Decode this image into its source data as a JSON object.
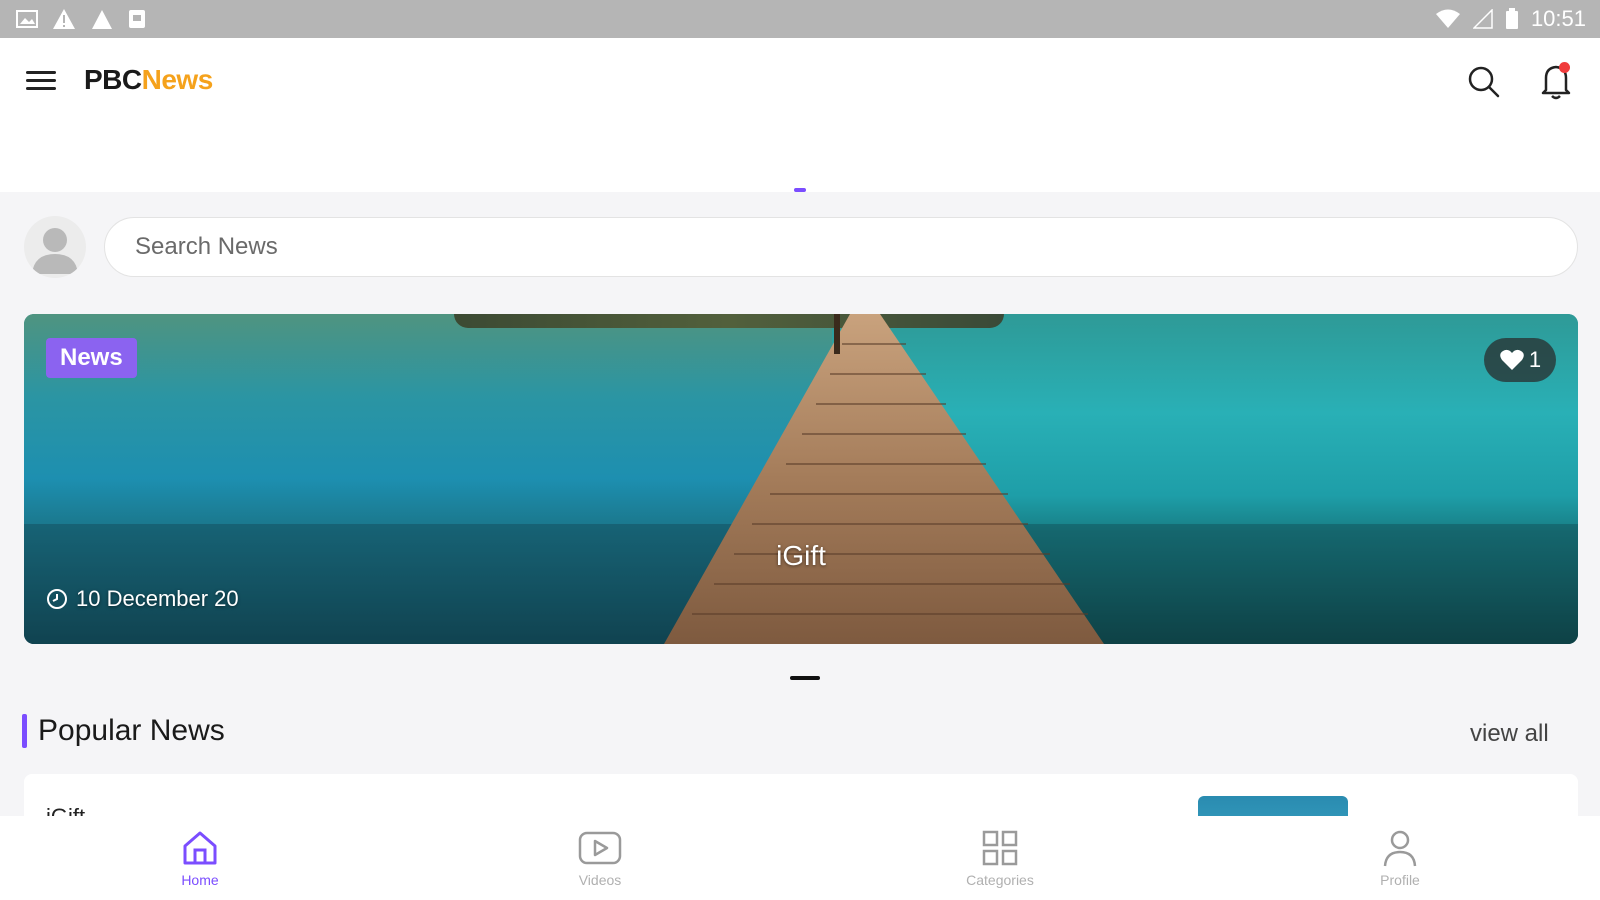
{
  "status_bar": {
    "time": "10:51"
  },
  "app": {
    "logo_prefix": "PBC",
    "logo_suffix": "News",
    "accent": "#7b4dff",
    "logo_accent": "#f5a21c"
  },
  "search": {
    "placeholder": "Search News"
  },
  "hero": {
    "category": "News",
    "likes": "1",
    "title": "iGift",
    "date": "10 December 20",
    "category_color": "#8b63f0"
  },
  "popular": {
    "title": "Popular News",
    "view_all": "view all",
    "items": [
      {
        "title": "iGift"
      }
    ]
  },
  "bottom_nav": [
    {
      "label": "Home",
      "icon": "home-icon",
      "active": true
    },
    {
      "label": "Videos",
      "icon": "play-icon",
      "active": false
    },
    {
      "label": "Categories",
      "icon": "grid-icon",
      "active": false
    },
    {
      "label": "Profile",
      "icon": "person-icon",
      "active": false
    }
  ]
}
